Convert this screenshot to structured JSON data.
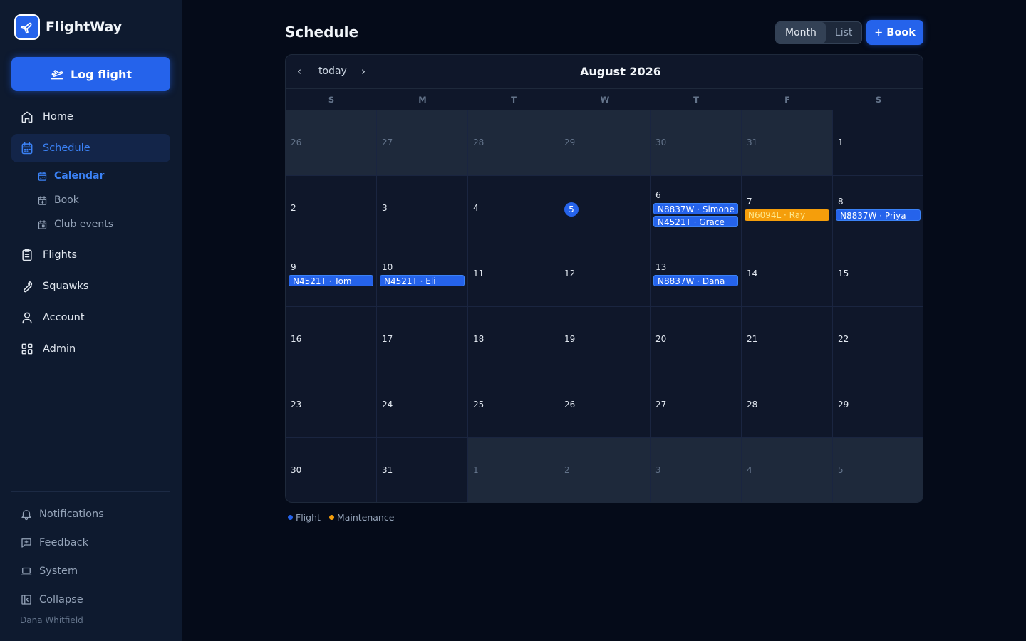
{
  "app": {
    "name": "FlightWay"
  },
  "sidebar": {
    "log_flight": "Log flight",
    "items": [
      {
        "label": "Home",
        "icon": "home-icon"
      },
      {
        "label": "Schedule",
        "icon": "calendar-icon",
        "active": true
      },
      {
        "label": "Flights",
        "icon": "clipboard-icon"
      },
      {
        "label": "Squawks",
        "icon": "wrench-icon"
      },
      {
        "label": "Account",
        "icon": "user-icon"
      },
      {
        "label": "Admin",
        "icon": "grid-icon"
      }
    ],
    "sub_items": [
      {
        "label": "Calendar",
        "icon": "calendar-icon",
        "active": true
      },
      {
        "label": "Book",
        "icon": "calendar-plus-icon"
      },
      {
        "label": "Club events",
        "icon": "calendar-event-icon"
      }
    ],
    "bottom_items": [
      {
        "label": "Notifications",
        "icon": "bell-icon"
      },
      {
        "label": "Feedback",
        "icon": "message-plus-icon"
      },
      {
        "label": "System",
        "icon": "laptop-icon"
      },
      {
        "label": "Collapse",
        "icon": "collapse-icon"
      }
    ],
    "user": "Dana Whitfield"
  },
  "header": {
    "title": "Schedule",
    "view_month": "Month",
    "view_list": "List",
    "book": "+ Book"
  },
  "calendar": {
    "prev": "‹",
    "today": "today",
    "next": "›",
    "month_title": "August 2026",
    "weekdays": [
      "S",
      "M",
      "T",
      "W",
      "T",
      "F",
      "S"
    ],
    "weeks": [
      [
        {
          "day": "26",
          "out": true
        },
        {
          "day": "27",
          "out": true
        },
        {
          "day": "28",
          "out": true
        },
        {
          "day": "29",
          "out": true
        },
        {
          "day": "30",
          "out": true
        },
        {
          "day": "31",
          "out": true
        },
        {
          "day": "1"
        }
      ],
      [
        {
          "day": "2"
        },
        {
          "day": "3"
        },
        {
          "day": "4"
        },
        {
          "day": "5",
          "today": true
        },
        {
          "day": "6",
          "events": [
            {
              "label": "N8837W · Simone",
              "type": "flight"
            },
            {
              "label": "N4521T · Grace",
              "type": "flight"
            }
          ]
        },
        {
          "day": "7",
          "events": [
            {
              "label": "N6094L · Ray",
              "type": "maintenance"
            }
          ]
        },
        {
          "day": "8",
          "events": [
            {
              "label": "N8837W · Priya",
              "type": "flight"
            }
          ]
        }
      ],
      [
        {
          "day": "9",
          "events": [
            {
              "label": "N4521T · Tom",
              "type": "flight"
            }
          ]
        },
        {
          "day": "10",
          "events": [
            {
              "label": "N4521T · Eli",
              "type": "flight"
            }
          ]
        },
        {
          "day": "11"
        },
        {
          "day": "12"
        },
        {
          "day": "13",
          "events": [
            {
              "label": "N8837W · Dana",
              "type": "flight"
            }
          ]
        },
        {
          "day": "14"
        },
        {
          "day": "15"
        }
      ],
      [
        {
          "day": "16"
        },
        {
          "day": "17"
        },
        {
          "day": "18"
        },
        {
          "day": "19"
        },
        {
          "day": "20"
        },
        {
          "day": "21"
        },
        {
          "day": "22"
        }
      ],
      [
        {
          "day": "23"
        },
        {
          "day": "24"
        },
        {
          "day": "25"
        },
        {
          "day": "26"
        },
        {
          "day": "27"
        },
        {
          "day": "28"
        },
        {
          "day": "29"
        }
      ],
      [
        {
          "day": "30"
        },
        {
          "day": "31"
        },
        {
          "day": "1",
          "out": true
        },
        {
          "day": "2",
          "out": true
        },
        {
          "day": "3",
          "out": true
        },
        {
          "day": "4",
          "out": true
        },
        {
          "day": "5",
          "out": true
        }
      ]
    ]
  },
  "legend": [
    {
      "label": "Flight",
      "color": "#2563eb"
    },
    {
      "label": "Maintenance",
      "color": "#f59e0b"
    }
  ],
  "colors": {
    "accent": "#2563eb",
    "maintenance": "#f59e0b",
    "background": "#050b19",
    "sidebar": "#0e1a2f"
  }
}
